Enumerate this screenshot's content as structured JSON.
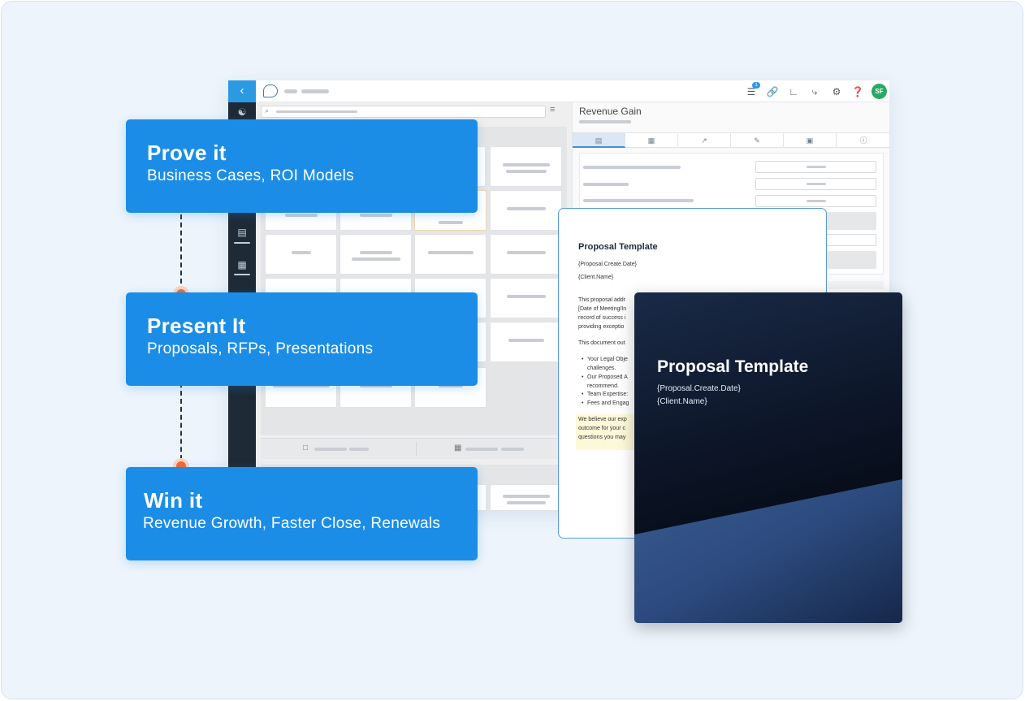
{
  "timeline": [
    {
      "title": "Prove it",
      "subtitle": "Business Cases, ROI Models"
    },
    {
      "title": "Present It",
      "subtitle": "Proposals, RFPs, Presentations"
    },
    {
      "title": "Win it",
      "subtitle": "Revenue Growth, Faster Close, Renewals"
    }
  ],
  "app": {
    "back_icon": "chevron-left-icon",
    "notification_count": "1",
    "avatar_initials": "SF",
    "right_panel_title": "Revenue Gain"
  },
  "doc_white": {
    "title": "Proposal Template",
    "create_date": "{Proposal.Create.Date}",
    "client_name": "{Client.Name}",
    "paragraph_lines": [
      "This proposal addr",
      "[Date of Meeting/In",
      "record of success i",
      "providing exceptio"
    ],
    "outline_line": "This document out",
    "bullets": [
      "Your Legal Obje",
      "challenges.",
      "Our Proposed A",
      "recommend.",
      "Team Expertise:",
      "Fees and Engag"
    ],
    "closing_lines": [
      "We believe our exp",
      "outcome for your c",
      "questions you may"
    ]
  },
  "doc_dark": {
    "title": "Proposal Template",
    "create_date": "{Proposal.Create.Date}",
    "client_name": "{Client.Name}"
  },
  "colors": {
    "card_blue": "#1c8de6",
    "timeline_dot": "#f26a32",
    "app_accent": "#2b9ae3",
    "avatar_green": "#2aa867"
  }
}
